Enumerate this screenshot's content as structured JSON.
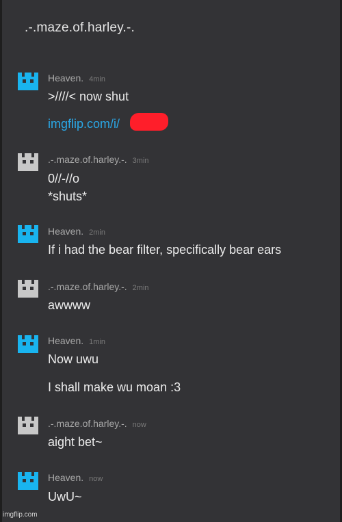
{
  "page": {
    "title": ".-.maze.of.harley.-.",
    "watermark": "imgflip.com"
  },
  "colors": {
    "heaven_avatar": "#19b4ef",
    "maze_avatar": "#c8c8c8",
    "link": "#2aa7e6",
    "redaction": "#ff1e2a"
  },
  "messages": [
    {
      "author": "Heaven.",
      "time": "4min",
      "avatar_icon": "discord-logo-icon",
      "lines": [
        ">////< now shut",
        "imgflip.com/i/"
      ]
    },
    {
      "author": ".-.maze.of.harley.-.",
      "time": "3min",
      "avatar_icon": "discord-logo-icon",
      "lines": [
        "0//-//o",
        "*shuts*"
      ]
    },
    {
      "author": "Heaven.",
      "time": "2min",
      "avatar_icon": "discord-logo-icon",
      "lines": [
        "If i had the bear filter, specifically bear ears"
      ]
    },
    {
      "author": ".-.maze.of.harley.-.",
      "time": "2min",
      "avatar_icon": "discord-logo-icon",
      "lines": [
        "awwww"
      ]
    },
    {
      "author": "Heaven.",
      "time": "1min",
      "avatar_icon": "discord-logo-icon",
      "lines": [
        "Now uwu",
        "I shall make wu moan :3"
      ]
    },
    {
      "author": ".-.maze.of.harley.-.",
      "time": "now",
      "avatar_icon": "discord-logo-icon",
      "lines": [
        "aight bet~"
      ]
    },
    {
      "author": "Heaven.",
      "time": "now",
      "avatar_icon": "discord-logo-icon",
      "lines": [
        "UwU~"
      ]
    }
  ]
}
